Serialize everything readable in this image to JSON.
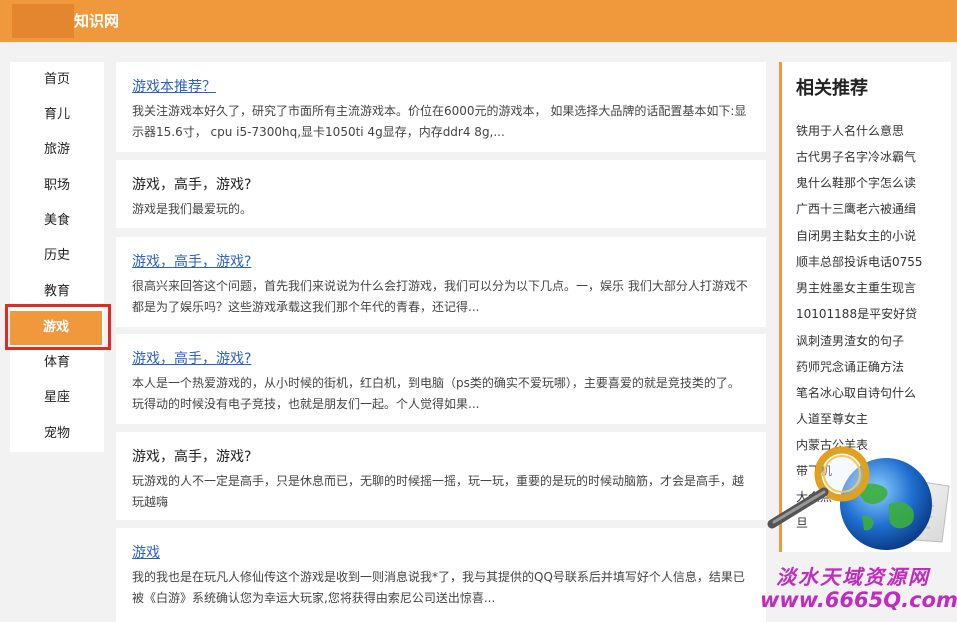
{
  "header": {
    "site_title": "知识网"
  },
  "nav": {
    "items": [
      "首页",
      "育儿",
      "旅游",
      "职场",
      "美食",
      "历史",
      "教育",
      "游戏",
      "体育",
      "星座",
      "宠物"
    ],
    "active_index": 7
  },
  "cards": [
    {
      "title": "游戏本推荐？",
      "title_link": true,
      "text": "我关注游戏本好久了，研究了市面所有主流游戏本。价位在6000元的游戏本， 如果选择大品牌的话配置基本如下:显示器15.6寸， cpu i5-7300hq,显卡1050ti 4g显存，内存ddr4 8g,..."
    },
    {
      "title": "游戏，高手，游戏?",
      "title_link": false,
      "text": "游戏是我们最爱玩的。"
    },
    {
      "title": "游戏，高手，游戏?",
      "title_link": true,
      "text": "很高兴来回答这个问题，首先我们来说说为什么会打游戏，我们可以分为以下几点。一，娱乐 我们大部分人打游戏不都是为了娱乐吗？这些游戏承载这我们那个年代的青春，还记得..."
    },
    {
      "title": "游戏，高手，游戏?",
      "title_link": true,
      "text": "本人是一个热爱游戏的，从小时候的街机，红白机，到电脑（ps类的确实不爱玩哪），主要喜爱的就是竞技类的了。玩得动的时候没有电子竞技，也就是朋友们一起。个人觉得如果..."
    },
    {
      "title": "游戏，高手，游戏?",
      "title_link": false,
      "text": "玩游戏的人不一定是高手，只是休息而已，无聊的时候摇一摇，玩一玩，重要的是玩的时候动脑筋，才会是高手，越玩越嗨"
    },
    {
      "title": "游戏",
      "title_link": true,
      "text": "我的我也是在玩凡人修仙传这个游戏是收到一则消息说我*了，我与其提供的QQ号联系后并填写好个人信息，结果已被《白游》系统确认您为幸运大玩家,您将获得由索尼公司送出惊喜..."
    }
  ],
  "related": {
    "title": "相关推荐",
    "items": [
      "铁用于人名什么意思",
      "古代男子名字冷冰霸气",
      "鬼什么鞋那个字怎么读",
      "广西十三鹰老六被通缉",
      "自闭男主黏女主的小说",
      "顺丰总部投诉电话0755",
      "男主姓墨女主重生现言",
      "10101188是平安好贷",
      "讽刺渣男渣女的句子",
      "药师咒念诵正确方法",
      "笔名冰心取自诗句什么",
      "人道至尊女主",
      "内蒙古公羊表",
      "带飞机",
      "大众点",
      "旦"
    ]
  },
  "watermark": {
    "text": "淡水天域资源网",
    "url": "www.6665Q.com"
  },
  "colors": {
    "accent": "#f0993c",
    "link": "#2c62c6",
    "highlight_box": "#e12a24",
    "watermark": "#c12bc0"
  }
}
